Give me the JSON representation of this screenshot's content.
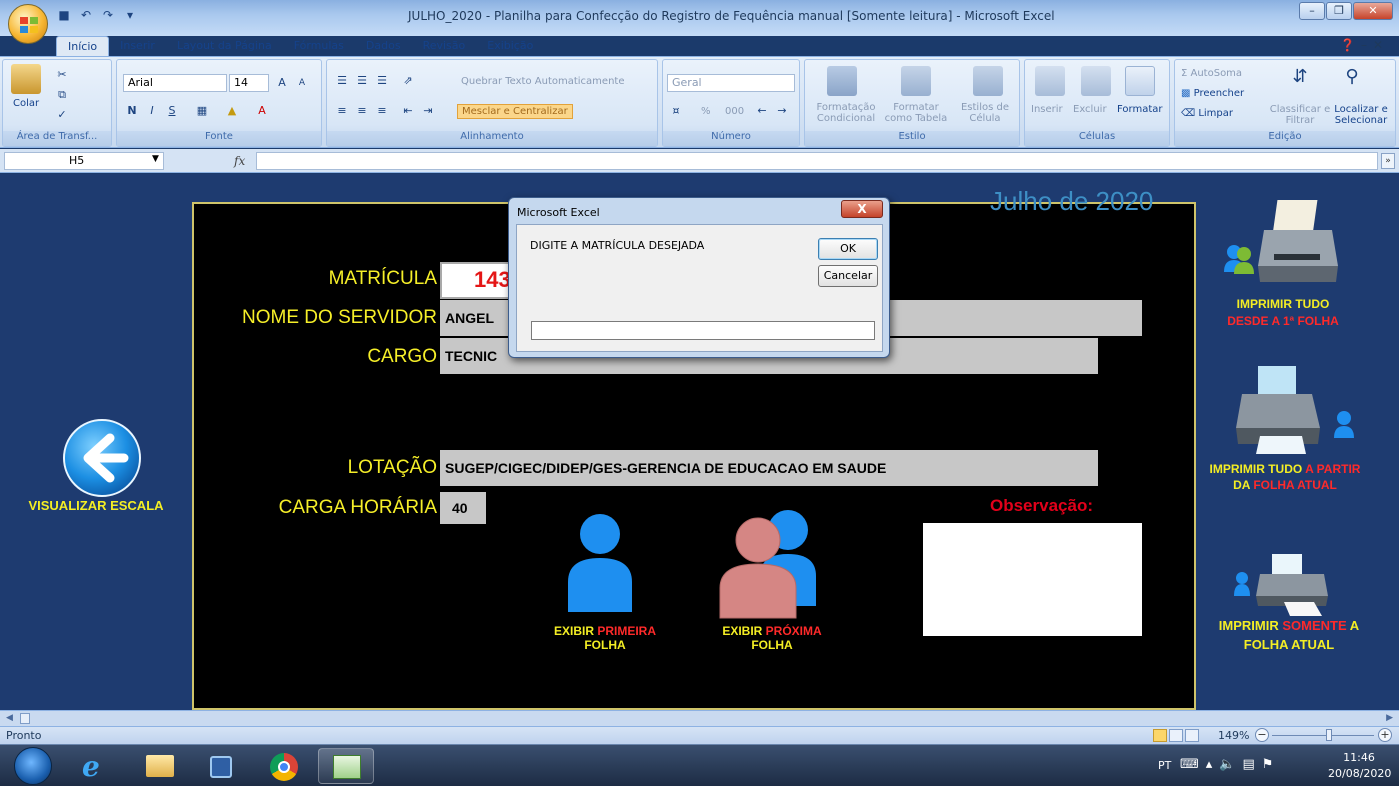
{
  "window": {
    "title": "JULHO_2020 - Planilha para Confecção do Registro de Fequência manual  [Somente leitura] - Microsoft Excel"
  },
  "ribbon": {
    "tabs": [
      "Início",
      "Inserir",
      "Layout da Página",
      "Fórmulas",
      "Dados",
      "Revisão",
      "Exibição"
    ],
    "active_tab": "Início",
    "clipboard": {
      "label": "Área de Transf...",
      "paste": "Colar"
    },
    "font": {
      "label": "Fonte",
      "name": "Arial",
      "size": "14",
      "bold": "N",
      "italic": "I",
      "underline": "S"
    },
    "alignment": {
      "label": "Alinhamento",
      "wrap": "Quebrar Texto Automaticamente",
      "merge": "Mesclar e Centralizar"
    },
    "number": {
      "label": "Número",
      "format": "Geral",
      "percent": "%",
      "thousands": "000"
    },
    "styles": {
      "label": "Estilo",
      "conditional": "Formatação Condicional",
      "table": "Formatar como Tabela",
      "cell": "Estilos de Célula"
    },
    "cells": {
      "label": "Células",
      "insert": "Inserir",
      "delete": "Excluir",
      "format": "Formatar"
    },
    "editing": {
      "label": "Edição",
      "autosum": "AutoSoma",
      "fill": "Preencher",
      "clear": "Limpar",
      "sort": "Classificar e Filtrar",
      "find": "Localizar e Selecionar"
    }
  },
  "formula_bar": {
    "name_box": "H5",
    "fx": "fx",
    "value": ""
  },
  "sheet": {
    "month": "Julho de 2020",
    "labels": {
      "matricula": "MATRÍCULA",
      "nome": "NOME DO SERVIDOR",
      "cargo": "CARGO",
      "lotacao": "LOTAÇÃO",
      "carga": "CARGA HORÁRIA",
      "observacao": "Observação:"
    },
    "values": {
      "matricula": "143",
      "nome": "ANGEL",
      "cargo": "TECNIC",
      "lotacao": "SUGEP/CIGEC/DIDEP/GES-GERENCIA DE EDUCACAO EM SAUDE",
      "carga": "40"
    },
    "left_action": {
      "label": "VISUALIZAR ESCALA"
    },
    "btn_first": {
      "line1a": "EXIBIR ",
      "line1b": "PRIMEIRA",
      "line2": "FOLHA"
    },
    "btn_next": {
      "line1a": "EXIBIR ",
      "line1b": "PRÓXIMA",
      "line2": "FOLHA"
    },
    "print_all": {
      "line1": "IMPRIMIR TUDO",
      "line2": "DESDE A 1ª FOLHA"
    },
    "print_from": {
      "line1a": "IMPRIMIR TUDO ",
      "line1b": "A PARTIR",
      "line2a": "DA ",
      "line2b": "FOLHA ATUAL"
    },
    "print_only": {
      "line1a": "IMPRIMIR  ",
      "line1b": "SOMENTE",
      "line1c": " A",
      "line2": "FOLHA ATUAL"
    }
  },
  "dialog": {
    "title": "Microsoft Excel",
    "close": "X",
    "prompt": "DIGITE A MATRÍCULA DESEJADA",
    "ok": "OK",
    "cancel": "Cancelar",
    "input_value": ""
  },
  "status": {
    "text": "Pronto",
    "zoom": "149%"
  },
  "taskbar": {
    "lang": "PT",
    "time": "11:46",
    "date": "20/08/2020"
  },
  "colors": {
    "label_yellow": "#f6ef29",
    "accent_red": "#ff2a2a",
    "month_blue": "#3d8fc5",
    "person_blue": "#1e8ff0",
    "person_pink": "#d58684",
    "sheet_bg": "#1e3b70"
  }
}
